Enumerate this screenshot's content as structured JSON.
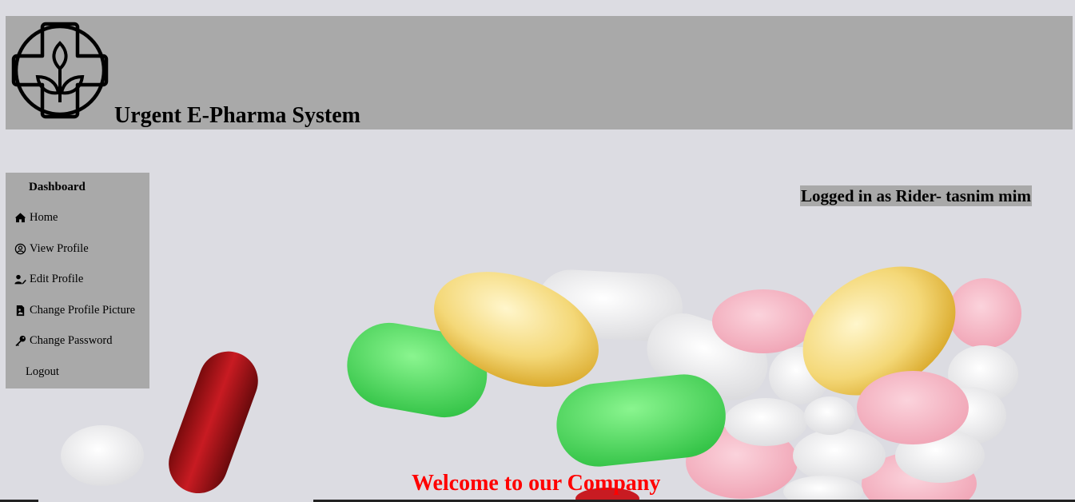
{
  "header": {
    "title": "Urgent E-Pharma System",
    "logo_icon": "pharmacy-cross-leaf-icon"
  },
  "sidebar": {
    "title": "Dashboard",
    "items": [
      {
        "label": "Home",
        "icon": "home-icon"
      },
      {
        "label": "View Profile",
        "icon": "user-circle-icon"
      },
      {
        "label": "Edit Profile",
        "icon": "user-edit-icon"
      },
      {
        "label": "Change Profile Picture",
        "icon": "file-image-icon"
      },
      {
        "label": "Change Password",
        "icon": "key-icon"
      },
      {
        "label": "Logout",
        "icon": ""
      }
    ]
  },
  "status": {
    "logged_in": "Logged in as Rider- tasnim mim"
  },
  "main": {
    "welcome": "Welcome to our Company"
  },
  "colors": {
    "header_bg": "#a9a9a9",
    "welcome": "#ff0000",
    "page_bg": "#dcdce2"
  }
}
